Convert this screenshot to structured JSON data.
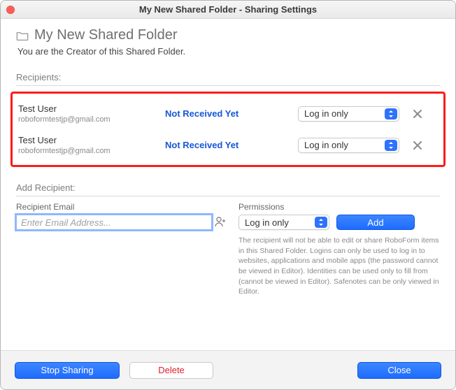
{
  "window": {
    "title": "My New Shared Folder - Sharing Settings"
  },
  "header": {
    "folder_name": "My New Shared Folder",
    "subtitle": "You are the Creator of this Shared Folder."
  },
  "sections": {
    "recipients_label": "Recipients:",
    "add_recipient_label": "Add Recipient:"
  },
  "recipients": [
    {
      "name": "Test User",
      "email": "roboformtestjp@gmail.com",
      "status": "Not Received Yet",
      "permission": "Log in only"
    },
    {
      "name": "Test User",
      "email": "roboformtestjp@gmail.com",
      "status": "Not Received Yet",
      "permission": "Log in only"
    }
  ],
  "add_form": {
    "email_label": "Recipient Email",
    "email_placeholder": "Enter Email Address...",
    "email_value": "",
    "permissions_label": "Permissions",
    "permission_value": "Log in only",
    "add_label": "Add",
    "permission_desc": "The recipient will not be able to edit or share RoboForm items in this Shared Folder. Logins can only be used to log in to websites, applications and mobile apps (the password cannot be viewed in Editor). Identities can be used only to fill from (cannot be viewed in Editor). Safenotes can be only viewed in Editor."
  },
  "footer": {
    "stop_sharing": "Stop Sharing",
    "delete": "Delete",
    "close": "Close"
  }
}
